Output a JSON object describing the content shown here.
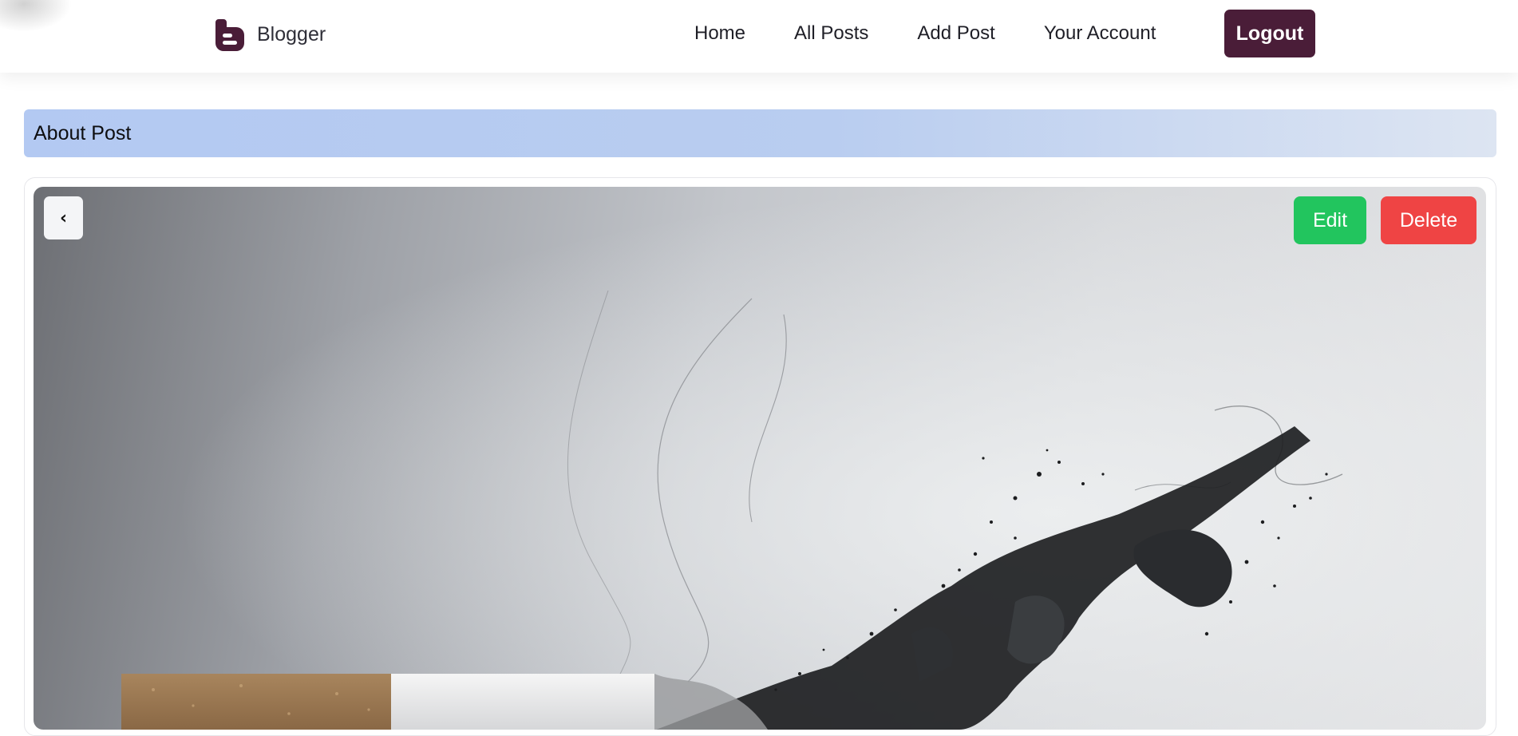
{
  "navbar": {
    "brand": {
      "name": "Blogger",
      "icon": "blogger-logo-icon",
      "color": "#4a1d38"
    },
    "links": [
      {
        "label": "Home"
      },
      {
        "label": "All Posts"
      },
      {
        "label": "Add Post"
      },
      {
        "label": "Your Account"
      }
    ],
    "logout_label": "Logout",
    "accent_color": "#4a1d38"
  },
  "section": {
    "title": "About Post"
  },
  "post": {
    "image_subject": "cigarette burning into smoke illustration",
    "back_icon": "chevron-left-icon",
    "edit_label": "Edit",
    "edit_color": "#22c55e",
    "delete_label": "Delete",
    "delete_color": "#ef4444"
  }
}
